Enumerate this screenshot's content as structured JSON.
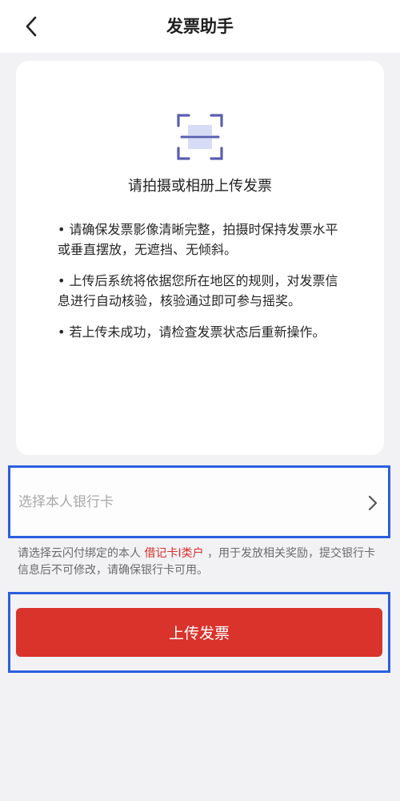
{
  "header": {
    "title": "发票助手",
    "back_icon": "chevron-left-icon"
  },
  "upload_card": {
    "icon": "scan-frame-icon",
    "heading": "请拍摄或相册上传发票",
    "tips": [
      "• 请确保发票影像清晰完整，拍摄时保持发票水平或垂直摆放，无遮挡、无倾斜。",
      "• 上传后系统将依据您所在地区的规则，对发票信息进行自动核验，核验通过即可参与摇奖。",
      "• 若上传未成功，请检查发票状态后重新操作。"
    ]
  },
  "bank_card": {
    "placeholder": "选择本人银行卡",
    "chevron_icon": "chevron-right-icon"
  },
  "note": {
    "prefix": "请选择云闪付绑定的本人 ",
    "highlight": "借记卡I类户",
    "suffix": " ，用于发放相关奖励，提交银行卡信息后不可修改，请确保银行卡可用。"
  },
  "actions": {
    "upload_label": "上传发票"
  },
  "colors": {
    "accent_red": "#d9332c",
    "highlight_border": "#2b5fe0",
    "icon_purple": "#5a5fb0"
  }
}
